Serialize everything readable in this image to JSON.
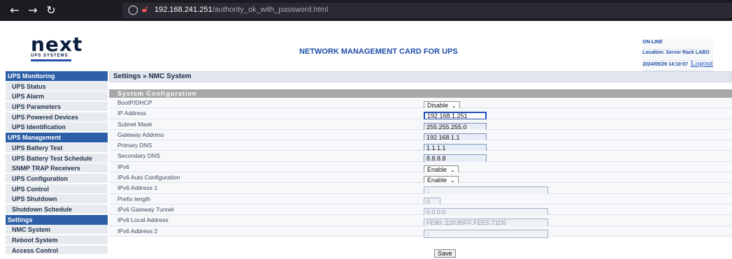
{
  "browser": {
    "url_host": "192.168.241.251",
    "url_path": "/authority_ok_with_password.html"
  },
  "header": {
    "logo_main": "next",
    "logo_sub": "UPS SYSTEMS",
    "title": "NETWORK MANAGEMENT CARD FOR UPS",
    "status": "ON-LINE",
    "location": "Location: Server Rack LABO",
    "datetime": "2024/05/29 14:10:07",
    "logout": "Logout"
  },
  "sidebar": {
    "items": [
      {
        "label": "UPS Monitoring",
        "type": "head"
      },
      {
        "label": "UPS Status",
        "type": "sub"
      },
      {
        "label": "UPS Alarm",
        "type": "sub"
      },
      {
        "label": "UPS Parameters",
        "type": "sub"
      },
      {
        "label": "UPS Powered Devices",
        "type": "sub"
      },
      {
        "label": "UPS Identification",
        "type": "sub"
      },
      {
        "label": "UPS Management",
        "type": "head"
      },
      {
        "label": "UPS Battery Test",
        "type": "sub"
      },
      {
        "label": "UPS Battery Test Schedule",
        "type": "sub"
      },
      {
        "label": "SNMP TRAP Receivers",
        "type": "sub"
      },
      {
        "label": "UPS Configuration",
        "type": "sub"
      },
      {
        "label": "UPS Control",
        "type": "sub"
      },
      {
        "label": "UPS Shutdown",
        "type": "sub"
      },
      {
        "label": "Shutdown Schedule",
        "type": "sub"
      },
      {
        "label": "Settings",
        "type": "head"
      },
      {
        "label": "NMC System",
        "type": "sub"
      },
      {
        "label": "Reboot System",
        "type": "sub"
      },
      {
        "label": "Access Control",
        "type": "sub"
      }
    ]
  },
  "main": {
    "breadcrumb": "Settings » NMC System",
    "section_title": "System Configuration",
    "rows": [
      {
        "label": "BootP/DHCP",
        "kind": "select",
        "value": "Disable"
      },
      {
        "label": "IP Address",
        "kind": "input",
        "value": "192.168.1.251",
        "state": "focused"
      },
      {
        "label": "Subnet Mask",
        "kind": "input",
        "value": "255.255.255.0"
      },
      {
        "label": "Gateway Address",
        "kind": "input",
        "value": "192.168.1.1"
      },
      {
        "label": "Primary DNS",
        "kind": "input",
        "value": "1.1.1.1"
      },
      {
        "label": "Secondary DNS",
        "kind": "input",
        "value": "8.8.8.8"
      },
      {
        "label": "IPv6",
        "kind": "select",
        "value": "Enable"
      },
      {
        "label": "IPv6 Auto Configuration",
        "kind": "select",
        "value": "Enable"
      },
      {
        "label": "IPv6 Address 1",
        "kind": "input",
        "value": "::",
        "state": "disabled",
        "size": "wide"
      },
      {
        "label": "Prefix length",
        "kind": "input",
        "value": "0",
        "state": "disabled",
        "size": "short"
      },
      {
        "label": "IPv6 Gateway Tunnel",
        "kind": "input",
        "value": "0.0.0.0",
        "state": "disabled",
        "size": "wide"
      },
      {
        "label": "IPv6 Local Address",
        "kind": "input",
        "value": "FE80::220:85FF:FEE5:71D5",
        "state": "disabled",
        "size": "wide"
      },
      {
        "label": "IPv6 Address 2",
        "kind": "input",
        "value": "::",
        "state": "disabled",
        "size": "wide"
      }
    ],
    "save_label": "Save"
  },
  "colors": {
    "sidebar_head": "#2c5fa8",
    "accent_text": "#1e4ca8",
    "section_head": "#a7a7a7"
  }
}
